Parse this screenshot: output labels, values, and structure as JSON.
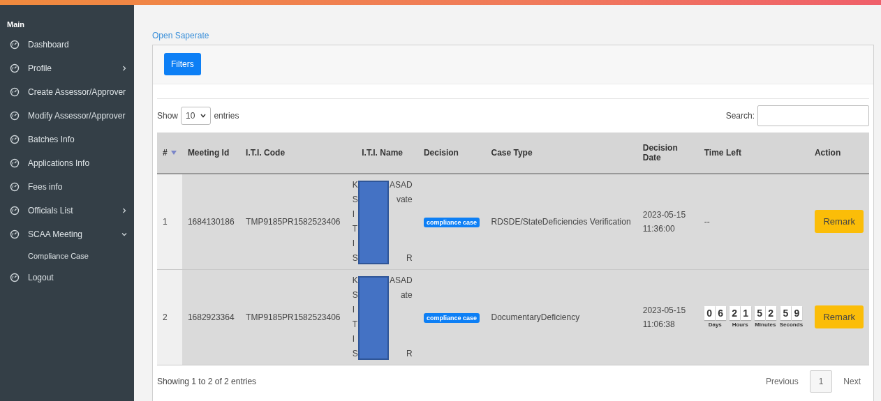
{
  "sidebar": {
    "heading": "Main",
    "items": [
      {
        "label": "Dashboard"
      },
      {
        "label": "Profile",
        "expanded": false
      },
      {
        "label": "Create Assessor/Approver"
      },
      {
        "label": "Modify Assessor/Approver"
      },
      {
        "label": "Batches Info"
      },
      {
        "label": "Applications Info"
      },
      {
        "label": "Fees info"
      },
      {
        "label": "Officials List",
        "expanded": false
      },
      {
        "label": "SCAA Meeting",
        "expanded": true,
        "children": [
          {
            "label": "Compliance Case"
          }
        ]
      },
      {
        "label": "Logout"
      }
    ]
  },
  "link": "Open Saperate",
  "filters_button": "Filters",
  "length": {
    "before": "Show",
    "value": "10",
    "after": "entries"
  },
  "search": {
    "label": "Search:"
  },
  "table": {
    "columns": [
      "#",
      "Meeting Id",
      "I.T.I. Code",
      "I.T.I. Name",
      "Decision",
      "Case Type",
      "Decision Date",
      "Time Left",
      "Action"
    ],
    "rows": [
      {
        "index": "1",
        "meeting_id": "1684130186",
        "iti_code": "TMP9185PR1582523406",
        "name_lines": [
          {
            "left": "K",
            "right": "ASAD"
          },
          {
            "left": "S",
            "right": "vate"
          },
          {
            "left": "I"
          },
          {
            "left": "T"
          },
          {
            "left": "I"
          },
          {
            "left": "S",
            "right": "R"
          }
        ],
        "decision": "compliance case",
        "case_type": "RDSDE/StateDeficiencies Verification",
        "date": "2023-05-15 11:36:00",
        "time_left": {
          "kind": "text",
          "text": "--"
        },
        "action": "Remark"
      },
      {
        "index": "2",
        "meeting_id": "1682923364",
        "iti_code": "TMP9185PR1582523406",
        "name_lines": [
          {
            "left": "K",
            "right": "ASAD"
          },
          {
            "left": "S",
            "right": "ate"
          },
          {
            "left": "I"
          },
          {
            "left": "T"
          },
          {
            "left": "I"
          },
          {
            "left": "S",
            "right": "R"
          }
        ],
        "decision": "compliance case",
        "case_type": "DocumentaryDeficiency",
        "date": "2023-05-15 11:06:38",
        "time_left": {
          "kind": "countdown",
          "units": [
            {
              "digits": [
                "0",
                "6"
              ],
              "label": "Days"
            },
            {
              "digits": [
                "2",
                "1"
              ],
              "label": "Hours"
            },
            {
              "digits": [
                "5",
                "2"
              ],
              "label": "Minutes"
            },
            {
              "digits": [
                "5",
                "9"
              ],
              "label": "Seconds"
            }
          ]
        },
        "action": "Remark"
      }
    ]
  },
  "footer": {
    "info": "Showing 1 to 2 of 2 entries",
    "previous": "Previous",
    "pages": [
      {
        "label": "1",
        "selected": true
      }
    ],
    "next": "Next"
  }
}
